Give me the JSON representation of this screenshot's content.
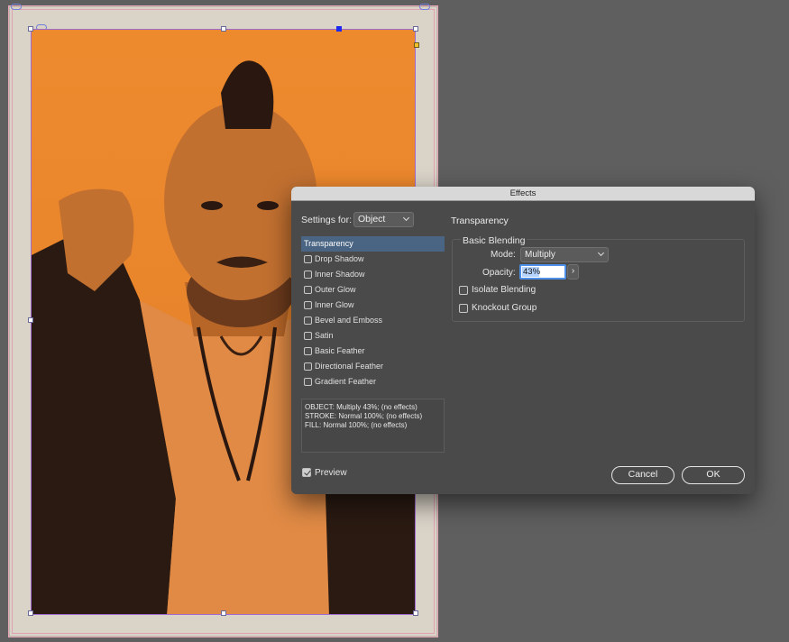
{
  "dialog": {
    "title": "Effects",
    "settings_for_label": "Settings for:",
    "settings_for_value": "Object",
    "effects": [
      {
        "label": "Transparency",
        "selected": true,
        "has_checkbox": false
      },
      {
        "label": "Drop Shadow",
        "checked": false
      },
      {
        "label": "Inner Shadow",
        "checked": false
      },
      {
        "label": "Outer Glow",
        "checked": false
      },
      {
        "label": "Inner Glow",
        "checked": false
      },
      {
        "label": "Bevel and Emboss",
        "checked": false
      },
      {
        "label": "Satin",
        "checked": false
      },
      {
        "label": "Basic Feather",
        "checked": false
      },
      {
        "label": "Directional Feather",
        "checked": false
      },
      {
        "label": "Gradient Feather",
        "checked": false
      }
    ],
    "summary": [
      "OBJECT: Multiply 43%; (no effects)",
      "STROKE: Normal 100%; (no effects)",
      "FILL: Normal 100%; (no effects)"
    ],
    "preview_label": "Preview",
    "preview_checked": true,
    "panel_title": "Transparency",
    "basic_blending_label": "Basic Blending",
    "mode_label": "Mode:",
    "mode_value": "Multiply",
    "opacity_label": "Opacity:",
    "opacity_value": "43%",
    "isolate_label": "Isolate Blending",
    "knockout_label": "Knockout Group",
    "cancel_label": "Cancel",
    "ok_label": "OK"
  },
  "colors": {
    "pasteboard": "#5f5f5f",
    "image_tint": "#ee8a2e",
    "dialog_bg": "#4a4a4a",
    "selection": "#4a6583"
  }
}
